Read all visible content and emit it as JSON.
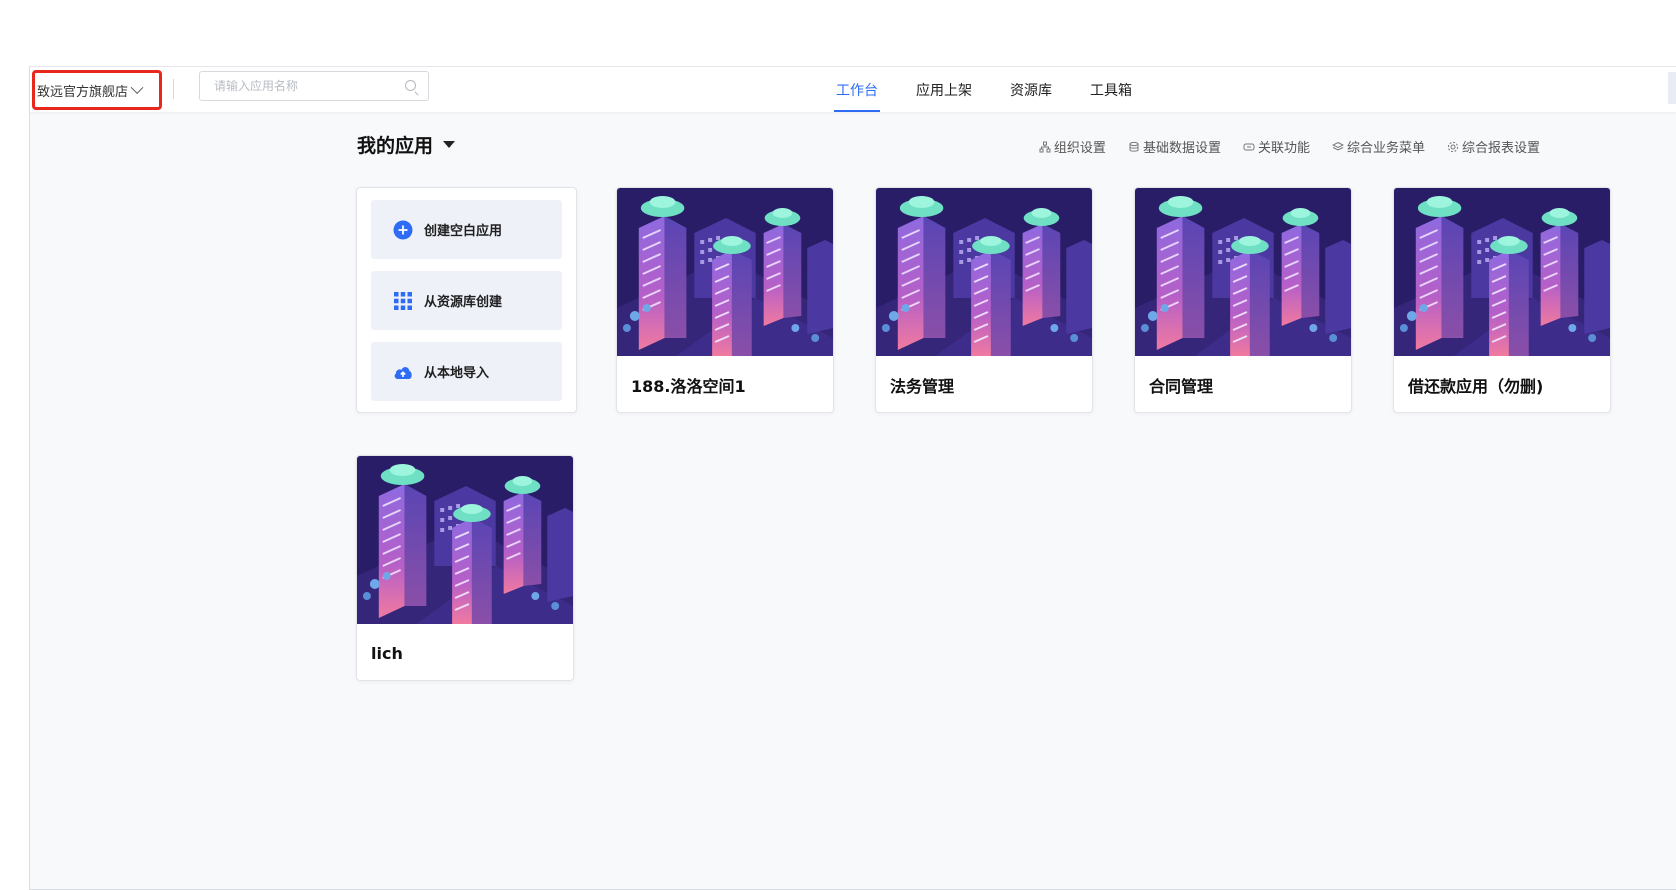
{
  "topbar": {
    "store_name": "致远官方旗舰店",
    "search_placeholder": "请输入应用名称",
    "tabs": [
      {
        "label": "工作台",
        "active": true
      },
      {
        "label": "应用上架",
        "active": false
      },
      {
        "label": "资源库",
        "active": false
      },
      {
        "label": "工具箱",
        "active": false
      }
    ]
  },
  "section": {
    "title": "我的应用",
    "links": [
      {
        "label": "组织设置",
        "icon": "org-icon"
      },
      {
        "label": "基础数据设置",
        "icon": "database-icon"
      },
      {
        "label": "关联功能",
        "icon": "link-icon"
      },
      {
        "label": "综合业务菜单",
        "icon": "layers-icon"
      },
      {
        "label": "综合报表设置",
        "icon": "gear-icon"
      }
    ]
  },
  "create": {
    "items": [
      {
        "label": "创建空白应用",
        "icon": "plus-circle-icon"
      },
      {
        "label": "从资源库创建",
        "icon": "grid-icon"
      },
      {
        "label": "从本地导入",
        "icon": "cloud-upload-icon"
      }
    ]
  },
  "apps": [
    {
      "name": "188.洛洛空间1"
    },
    {
      "name": "法务管理"
    },
    {
      "name": "合同管理"
    },
    {
      "name": "借还款应用（勿删)"
    },
    {
      "name": "lich"
    }
  ],
  "colors": {
    "accent": "#2f6cf6",
    "highlight_box": "#e8271d",
    "thumb_bg": "#2a1d68"
  }
}
